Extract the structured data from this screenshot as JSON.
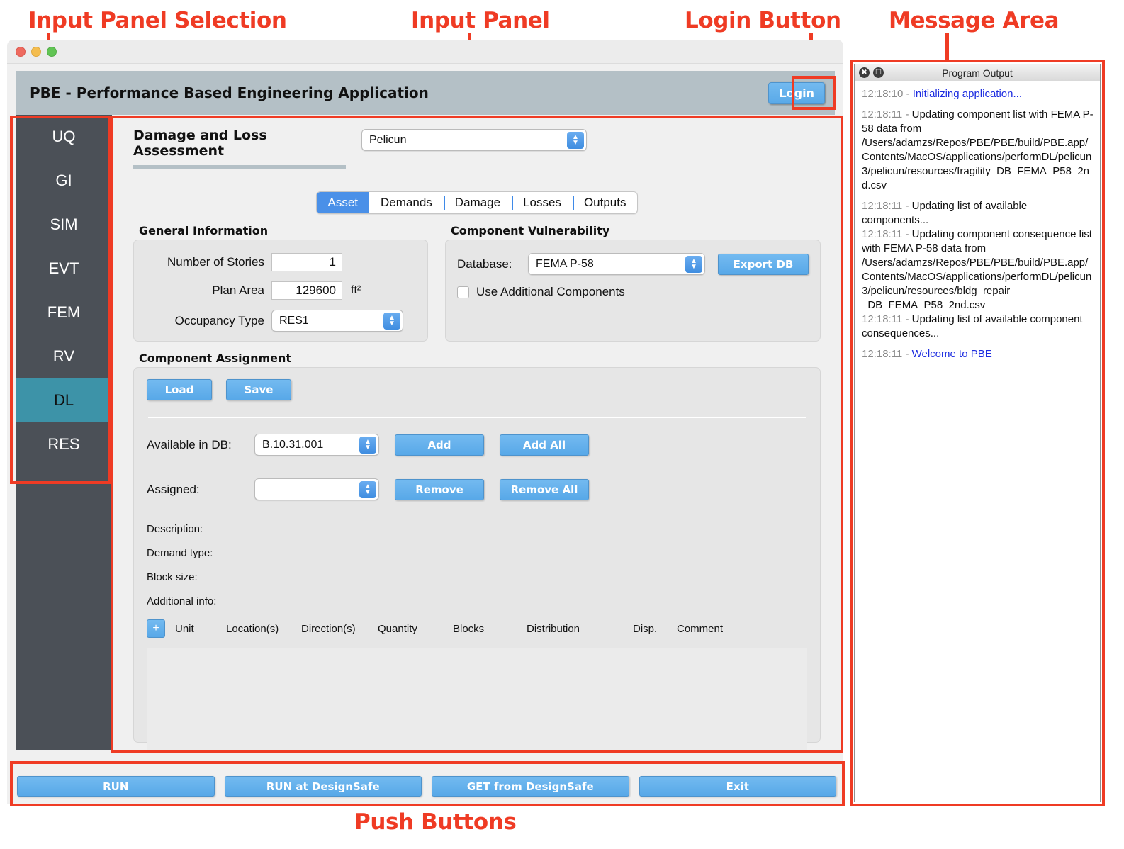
{
  "annotations": [
    {
      "label": "Input Panel Selection"
    },
    {
      "label": "Input Panel"
    },
    {
      "label": "Login Button"
    },
    {
      "label": "Message Area"
    },
    {
      "label": "Push Buttons"
    }
  ],
  "window": {
    "traffic_lights": [
      "close",
      "minimize",
      "zoom"
    ],
    "app_title": "PBE - Performance Based Engineering Application",
    "login_label": "Login"
  },
  "sidebar": {
    "items": [
      {
        "label": "UQ",
        "active": false
      },
      {
        "label": "GI",
        "active": false
      },
      {
        "label": "SIM",
        "active": false
      },
      {
        "label": "EVT",
        "active": false
      },
      {
        "label": "FEM",
        "active": false
      },
      {
        "label": "RV",
        "active": false
      },
      {
        "label": "DL",
        "active": true
      },
      {
        "label": "RES",
        "active": false
      }
    ]
  },
  "panel": {
    "title": "Damage and Loss Assessment",
    "engine": {
      "value": "Pelicun"
    },
    "tabs": [
      {
        "label": "Asset",
        "active": true
      },
      {
        "label": "Demands",
        "active": false
      },
      {
        "label": "Damage",
        "active": false
      },
      {
        "label": "Losses",
        "active": false
      },
      {
        "label": "Outputs",
        "active": false
      }
    ],
    "general_information": {
      "title": "General Information",
      "number_of_stories_label": "Number of Stories",
      "number_of_stories_value": "1",
      "plan_area_label": "Plan Area",
      "plan_area_value": "129600",
      "plan_area_unit": "ft²",
      "occupancy_type_label": "Occupancy Type",
      "occupancy_type_value": "RES1"
    },
    "component_vulnerability": {
      "title": "Component Vulnerability",
      "database_label": "Database:",
      "database_value": "FEMA P-58",
      "export_label": "Export DB",
      "use_additional_label": "Use Additional Components"
    },
    "component_assignment": {
      "title": "Component Assignment",
      "load_label": "Load",
      "save_label": "Save",
      "available_label": "Available in DB:",
      "available_value": "B.10.31.001",
      "add_label": "Add",
      "add_all_label": "Add All",
      "assigned_label": "Assigned:",
      "assigned_value": "",
      "remove_label": "Remove",
      "remove_all_label": "Remove All",
      "description_label": "Description:",
      "demand_type_label": "Demand type:",
      "block_size_label": "Block size:",
      "additional_info_label": "Additional info:",
      "add_row_label": "+",
      "columns": [
        "Unit",
        "Location(s)",
        "Direction(s)",
        "Quantity",
        "Blocks",
        "Distribution",
        "Disp.",
        "Comment"
      ],
      "rows": []
    }
  },
  "push_buttons": [
    {
      "label": "RUN"
    },
    {
      "label": "RUN at DesignSafe"
    },
    {
      "label": "GET from DesignSafe"
    },
    {
      "label": "Exit"
    }
  ],
  "program_output": {
    "title": "Program Output",
    "messages": [
      {
        "time": "12:18:10",
        "text": "Initializing application...",
        "style": "blue"
      },
      {
        "time": "12:18:11",
        "text": "Updating component list with FEMA P-58 data from /Users/adamzs/Repos/PBE/PBE/build/PBE.app/Contents/MacOS/applications/performDL/pelicun3/pelicun/resources/fragility_DB_FEMA_P58_2nd.csv",
        "style": "normal"
      },
      {
        "time": "12:18:11",
        "text": "Updating list of available components...",
        "style": "normal",
        "tight": true
      },
      {
        "time": "12:18:11",
        "text": "Updating component consequence list with FEMA P-58 data from /Users/adamzs/Repos/PBE/PBE/build/PBE.app/Contents/MacOS/applications/performDL/pelicun3/pelicun/resources/bldg_repair _DB_FEMA_P58_2nd.csv",
        "style": "normal",
        "tight": true
      },
      {
        "time": "12:18:11",
        "text": "Updating list of available component consequences...",
        "style": "normal"
      },
      {
        "time": "12:18:11",
        "text": "Welcome to PBE",
        "style": "blue"
      }
    ]
  },
  "colors": {
    "accent_blue": "#58a8e8",
    "sidebar_bg": "#4b5057",
    "sidebar_active": "#3d93a8",
    "app_header": "#b4c0c6",
    "annotation_red": "#ef3b24",
    "tab_active": "#4a90e8",
    "link_blue": "#1c2ce0"
  }
}
